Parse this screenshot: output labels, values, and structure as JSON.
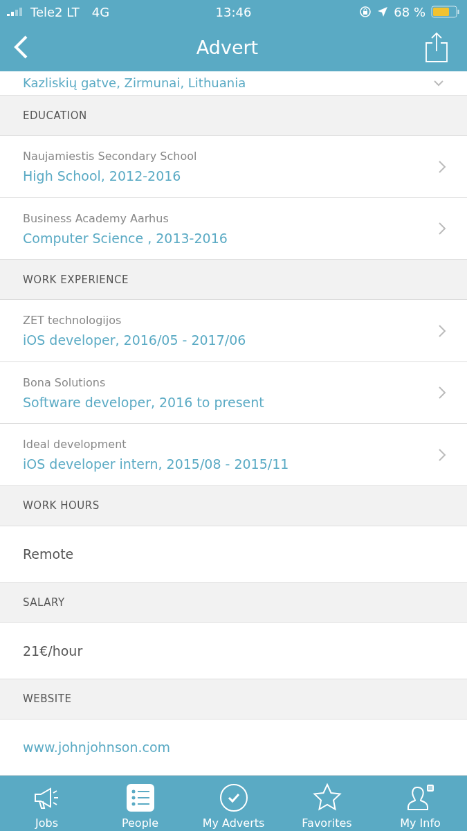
{
  "status_bar": {
    "carrier": "Tele2 LT",
    "network": "4G",
    "time": "13:46",
    "battery": "68 %"
  },
  "nav": {
    "title": "Advert"
  },
  "address": {
    "text": "Kazliskių gatve, Zirmunai, Lithuania"
  },
  "sections": [
    {
      "title": "EDUCATION",
      "rows": [
        {
          "kind": "detail",
          "subtitle": "Naujamiestis Secondary School",
          "title": "High School, 2012-2016"
        },
        {
          "kind": "detail",
          "subtitle": "Business Academy Aarhus",
          "title": "Computer Science , 2013-2016"
        }
      ]
    },
    {
      "title": "WORK EXPERIENCE",
      "rows": [
        {
          "kind": "detail",
          "subtitle": "ZET technologijos",
          "title": "iOS developer, 2016/05 - 2017/06"
        },
        {
          "kind": "detail",
          "subtitle": "Bona Solutions",
          "title": "Software developer, 2016 to present"
        },
        {
          "kind": "detail",
          "subtitle": "Ideal development",
          "title": "iOS developer intern, 2015/08 - 2015/11"
        }
      ]
    },
    {
      "title": "WORK HOURS",
      "rows": [
        {
          "kind": "plain",
          "title": "Remote"
        }
      ]
    },
    {
      "title": "SALARY",
      "rows": [
        {
          "kind": "plain",
          "title": "21€/hour"
        }
      ]
    },
    {
      "title": "WEBSITE",
      "rows": [
        {
          "kind": "link",
          "title": "www.johnjohnson.com"
        }
      ]
    }
  ],
  "tabs": [
    {
      "kind": "jobs",
      "label": "Jobs",
      "selected": false
    },
    {
      "kind": "people",
      "label": "People",
      "selected": true
    },
    {
      "kind": "adverts",
      "label": "My Adverts",
      "selected": false
    },
    {
      "kind": "favorites",
      "label": "Favorites",
      "selected": false
    },
    {
      "kind": "info",
      "label": "My Info",
      "selected": false
    }
  ]
}
